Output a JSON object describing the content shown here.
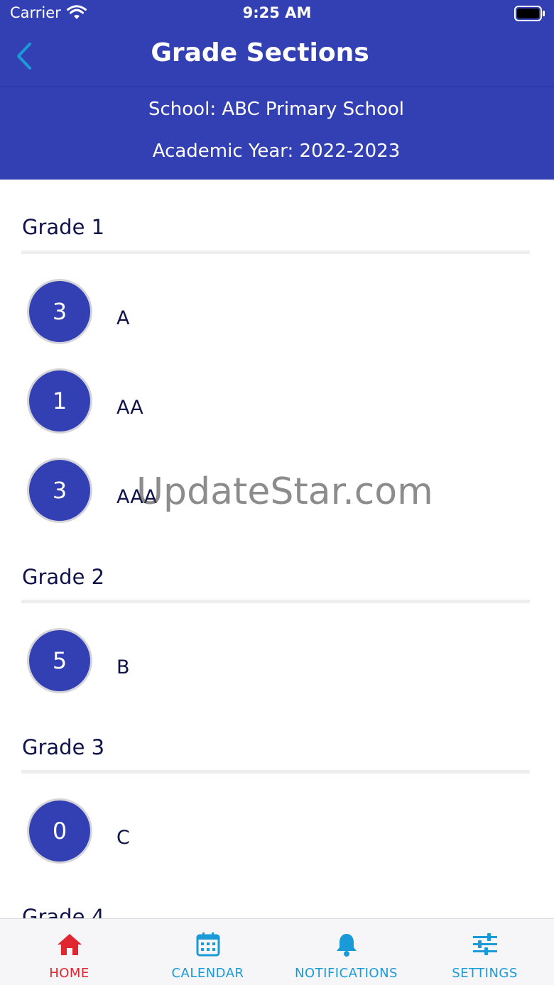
{
  "status_bar": {
    "carrier": "Carrier",
    "time": "9:25 AM"
  },
  "nav": {
    "title": "Grade Sections"
  },
  "info": {
    "school": "School: ABC Primary School",
    "year": "Academic Year: 2022-2023"
  },
  "grades": [
    {
      "name": "Grade 1",
      "sections": [
        {
          "count": "3",
          "name": "A"
        },
        {
          "count": "1",
          "name": "AA"
        },
        {
          "count": "3",
          "name": "AAA"
        }
      ]
    },
    {
      "name": "Grade 2",
      "sections": [
        {
          "count": "5",
          "name": "B"
        }
      ]
    },
    {
      "name": "Grade 3",
      "sections": [
        {
          "count": "0",
          "name": "C"
        }
      ]
    },
    {
      "name": "Grade 4",
      "sections": []
    }
  ],
  "watermark": "UpdateStar.com",
  "tabs": [
    {
      "label": "HOME",
      "icon": "home-icon",
      "color": "#e0262e"
    },
    {
      "label": "CALENDAR",
      "icon": "calendar-icon",
      "color": "#1a9ad6"
    },
    {
      "label": "NOTIFICATIONS",
      "icon": "bell-icon",
      "color": "#1a9ad6"
    },
    {
      "label": "SETTINGS",
      "icon": "sliders-icon",
      "color": "#1a9ad6"
    }
  ],
  "colors": {
    "primary": "#3340b3",
    "active_tab": "#e0262e",
    "inactive_tab": "#1a9ad6"
  }
}
